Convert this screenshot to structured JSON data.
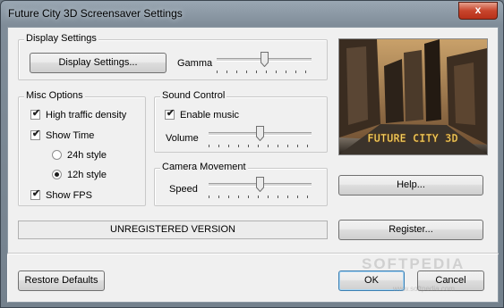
{
  "window": {
    "title": "Future City 3D Screensaver Settings",
    "close_label": "x"
  },
  "display_settings": {
    "legend": "Display Settings",
    "button_label": "Display Settings...",
    "gamma_label": "Gamma",
    "gamma_level": 0.5
  },
  "misc_options": {
    "legend": "Misc Options",
    "high_traffic": {
      "label": "High traffic density",
      "checked": true
    },
    "show_time": {
      "label": "Show Time",
      "checked": true
    },
    "style_24h": {
      "label": "24h style",
      "selected": false
    },
    "style_12h": {
      "label": "12h style",
      "selected": true
    },
    "show_fps": {
      "label": "Show FPS",
      "checked": true
    }
  },
  "sound_control": {
    "legend": "Sound Control",
    "enable_music": {
      "label": "Enable music",
      "checked": true
    },
    "volume_label": "Volume",
    "volume_level": 0.5
  },
  "camera_movement": {
    "legend": "Camera Movement",
    "speed_label": "Speed",
    "speed_level": 0.5
  },
  "preview": {
    "logo_text": "FUTURE CITY 3D"
  },
  "buttons": {
    "help": "Help...",
    "register": "Register...",
    "restore_defaults": "Restore Defaults",
    "ok": "OK",
    "cancel": "Cancel"
  },
  "status": {
    "registration": "UNREGISTERED VERSION"
  },
  "watermark": {
    "text": "SOFTPEDIA",
    "sub": "www.softpedia.com"
  },
  "check_mark": "✔"
}
